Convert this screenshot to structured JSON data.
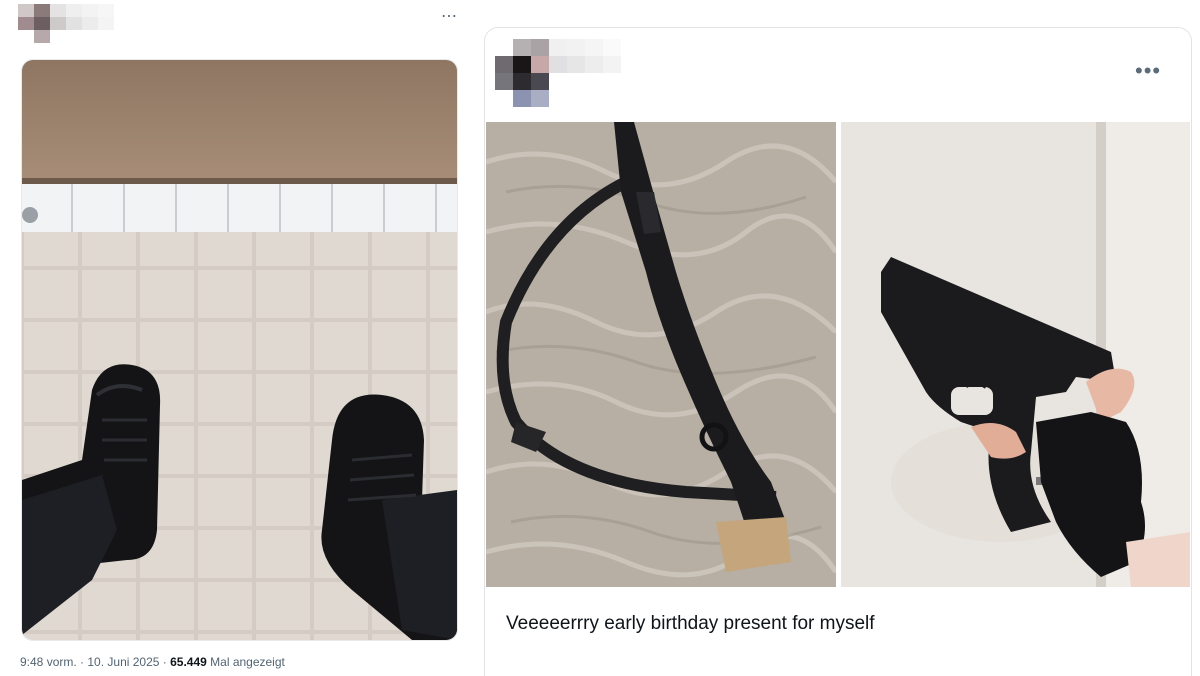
{
  "left_post": {
    "more_icon": "⋯",
    "photo_alt": "Feet in black boots on tiled floor",
    "time": "9:48 vorm.",
    "dot1": " · ",
    "date": "10. Juni 2025",
    "dot2": " · ",
    "views": "65.449",
    "views_label": " Mal angezeigt"
  },
  "right_post": {
    "more_icon": "•••",
    "caption": "Veeeeerrry early birthday present for myself"
  },
  "colors": {
    "meta_gray": "#536471",
    "text_dark": "#0f1419",
    "card_border": "#e1e4e6"
  }
}
